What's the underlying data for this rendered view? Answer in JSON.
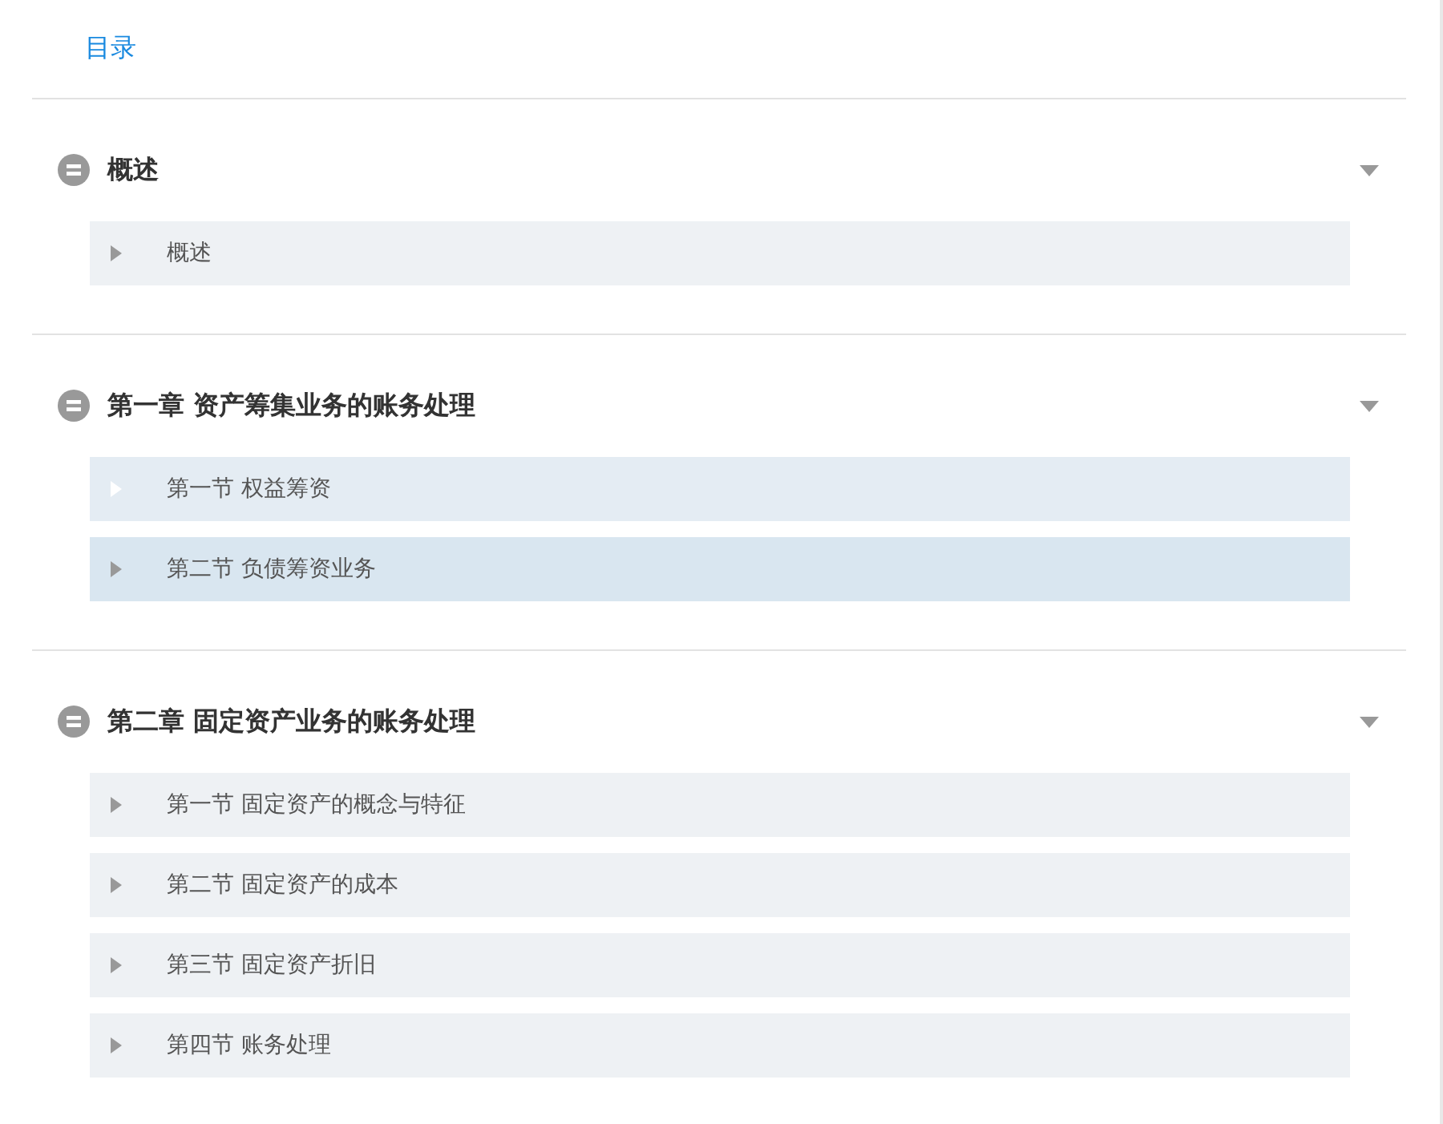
{
  "header": {
    "title": "目录"
  },
  "sections": [
    {
      "title": "概述",
      "expanded": true,
      "items": [
        {
          "label": "概述",
          "hovered": false,
          "selected": false
        }
      ]
    },
    {
      "title": "第一章 资产筹集业务的账务处理",
      "expanded": true,
      "items": [
        {
          "label": "第一节 权益筹资",
          "hovered": true,
          "selected": false
        },
        {
          "label": "第二节 负债筹资业务",
          "hovered": false,
          "selected": true
        }
      ]
    },
    {
      "title": "第二章 固定资产业务的账务处理",
      "expanded": true,
      "items": [
        {
          "label": "第一节 固定资产的概念与特征",
          "hovered": false,
          "selected": false
        },
        {
          "label": "第二节 固定资产的成本",
          "hovered": false,
          "selected": false
        },
        {
          "label": "第三节 固定资产折旧",
          "hovered": false,
          "selected": false
        },
        {
          "label": "第四节 账务处理",
          "hovered": false,
          "selected": false
        }
      ]
    }
  ]
}
